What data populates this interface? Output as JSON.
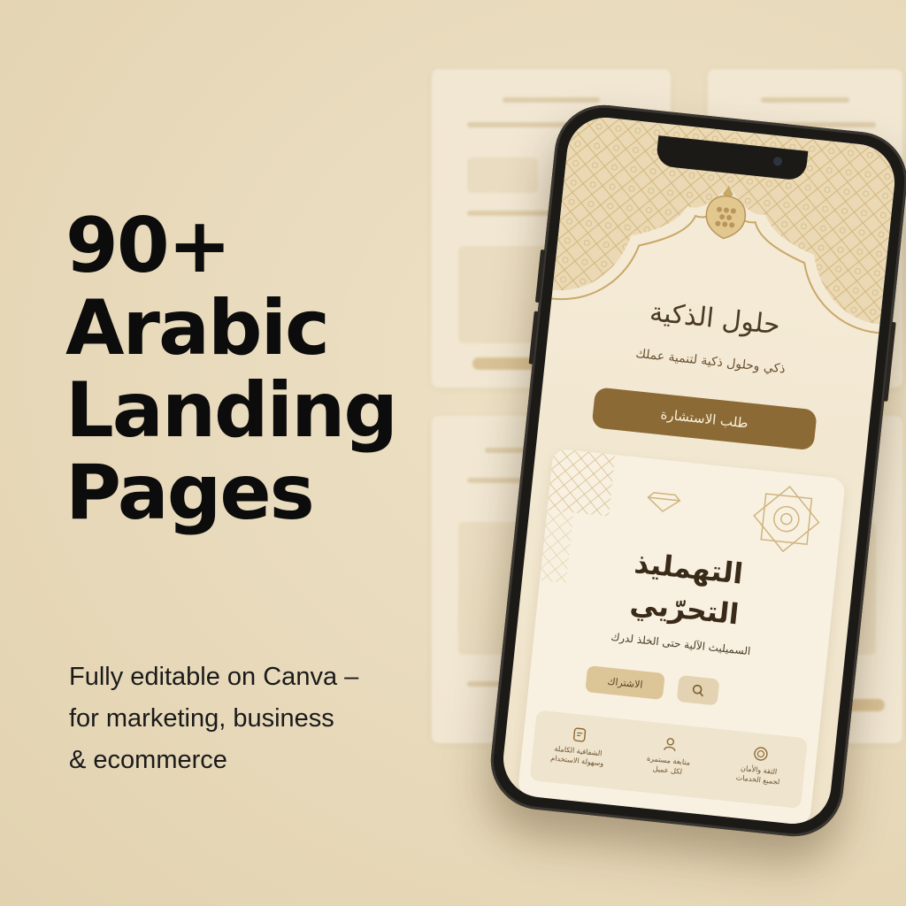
{
  "headline": {
    "line1": "90+",
    "line2": "Arabic",
    "line3": "Landing",
    "line4": "Pages"
  },
  "subline": {
    "line1": "Fully editable on Canva –",
    "line2": "for marketing, business",
    "line3": "& ecommerce"
  },
  "phone_screen": {
    "hero_title": "حلول الذكية",
    "hero_subtitle": "ذكي وحلول ذكية لتنمية عملك",
    "cta_label": "طلب الاستشارة",
    "card": {
      "title_line1": "التهمليذ",
      "title_line2": "التحرّيي",
      "subtitle": "السميليث الآلية حتى الخلذ لدرك",
      "primary_button": "الاشتراك",
      "search_icon": "search-icon",
      "features": [
        {
          "icon": "document-icon",
          "label_line1": "الشفافية الكاملة",
          "label_line2": "وسهولة الاستخدام"
        },
        {
          "icon": "user-icon",
          "label_line1": "متابعة مستمرة",
          "label_line2": "لكل عميل"
        },
        {
          "icon": "badge-icon",
          "label_line1": "الثقة والأمان",
          "label_line2": "لجميع الخدمات"
        }
      ]
    }
  },
  "colors": {
    "background": "#e9dbbd",
    "headline": "#0c0c0c",
    "cta": "#8c6a35",
    "phone_frame": "#1c1a17",
    "accent_gold": "#d6bc8c"
  }
}
